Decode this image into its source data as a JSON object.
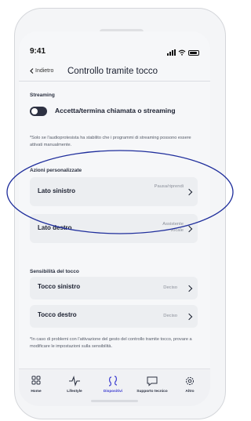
{
  "status": {
    "time": "9:41"
  },
  "nav": {
    "back_label": "Indietro",
    "title": "Controllo tramite tocco"
  },
  "streaming": {
    "heading": "Streaming",
    "toggle_label": "Accetta/termina chiamata o streaming",
    "note": "*Solo se l'audioprotesista ha stabilito che i programmi di streaming possono essere attivati manualmente."
  },
  "custom_actions": {
    "heading": "Azioni personalizzate",
    "items": [
      {
        "label": "Lato sinistro",
        "value": "Pausa/riprendi"
      },
      {
        "label": "Lato destro",
        "value": "Assistente vocale"
      }
    ]
  },
  "sensitivity": {
    "heading": "Sensibilità del tocco",
    "items": [
      {
        "label": "Tocco sinistro",
        "value": "Deciso"
      },
      {
        "label": "Tocco destro",
        "value": "Deciso"
      }
    ],
    "note": "*In caso di problemi con l'attivazione del gesto del controllo tramite tocco, provare a modificare le impostazioni sulla sensibilità."
  },
  "tabbar": {
    "items": [
      {
        "label": "Home",
        "icon": "grid-icon"
      },
      {
        "label": "Lifestyle",
        "icon": "activity-icon"
      },
      {
        "label": "Dispositivi",
        "icon": "hearing-aids-icon"
      },
      {
        "label": "Supporto tecnico",
        "icon": "chat-icon"
      },
      {
        "label": "Altro",
        "icon": "gear-icon"
      }
    ],
    "active_index": 2
  },
  "colors": {
    "accent": "#3a3ad0",
    "annotation_ellipse": "#1f2e9c",
    "toggle_off": "#2d3142"
  }
}
